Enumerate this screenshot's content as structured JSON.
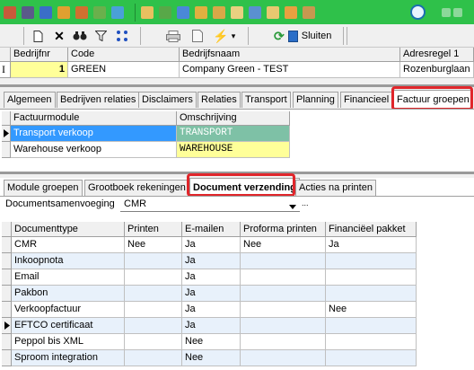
{
  "toolbar2": {
    "sluiten_label": "Sluiten",
    "lightning_dropdown": "▾"
  },
  "main_grid": {
    "headers": [
      "Bedrijfnr",
      "Code",
      "Bedrijfsnaam",
      "Adresregel 1"
    ],
    "row": {
      "bedrijfnr": "1",
      "code": "GREEN",
      "bedrijfsnaam": "Company Green - TEST",
      "adres": "Rozenburglaan"
    }
  },
  "tabs1": [
    "Algemeen",
    "Bedrijven relaties",
    "Disclaimers",
    "Relaties",
    "Transport",
    "Planning",
    "Financieel",
    "Factuur groepen"
  ],
  "factuur_grid": {
    "headers": [
      "Factuurmodule",
      "Omschrijving"
    ],
    "rows": [
      {
        "module": "Transport verkoop",
        "omschrijving": "TRANSPORT"
      },
      {
        "module": "Warehouse verkoop",
        "omschrijving": "WAREHOUSE"
      }
    ]
  },
  "tabs2": [
    "Module groepen",
    "Grootboek rekeningen",
    "Document verzending",
    "Acties na printen"
  ],
  "doc_samenvoeging": {
    "label": "Documentsamenvoeging",
    "value": "CMR",
    "ellipsis": "..."
  },
  "doc_grid": {
    "headers": [
      "Documenttype",
      "Printen",
      "E-mailen",
      "Proforma printen",
      "Financiëel pakket"
    ],
    "rows": [
      [
        "CMR",
        "Nee",
        "Ja",
        "Nee",
        "Ja"
      ],
      [
        "Inkoopnota",
        "",
        "Ja",
        "",
        ""
      ],
      [
        "Email",
        "",
        "Ja",
        "",
        ""
      ],
      [
        "Pakbon",
        "",
        "Ja",
        "",
        ""
      ],
      [
        "Verkoopfactuur",
        "",
        "Ja",
        "",
        "Nee"
      ],
      [
        "EFTCO certificaat",
        "",
        "Ja",
        "",
        ""
      ],
      [
        "Peppol bis XML",
        "",
        "Nee",
        "",
        ""
      ],
      [
        "Sproom integration",
        "",
        "Nee",
        "",
        ""
      ]
    ]
  },
  "colors": {
    "topbar": "#2fc14a",
    "selection": "#3399ff",
    "highlight_red": "#e0262b"
  }
}
